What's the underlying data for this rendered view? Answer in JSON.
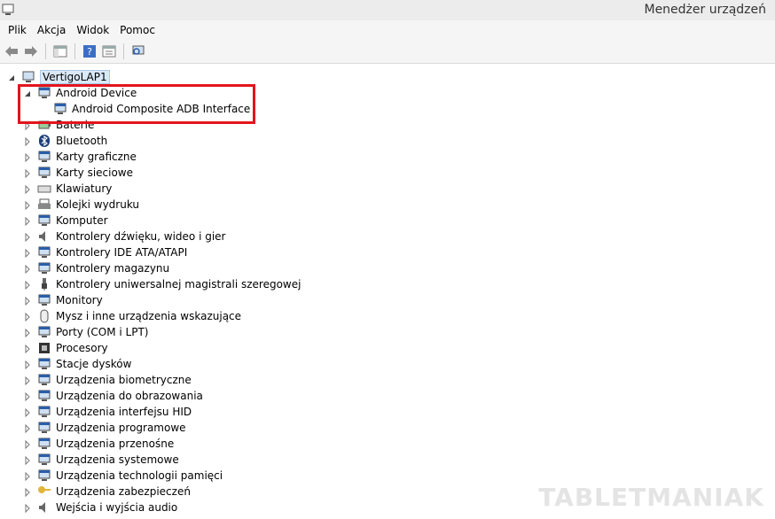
{
  "window": {
    "title": "Menedżer urządzeń"
  },
  "menu": [
    "Plik",
    "Akcja",
    "Widok",
    "Pomoc"
  ],
  "toolbar": [
    "back-icon",
    "forward-icon",
    "show-hide-tree-icon",
    "help-icon",
    "properties-icon",
    "scan-hardware-icon"
  ],
  "tree": {
    "root": "VertigoLAP1",
    "categories": [
      {
        "label": "Android Device",
        "expanded": true,
        "children": [
          "Android Composite ADB Interface"
        ]
      },
      {
        "label": "Baterie"
      },
      {
        "label": "Bluetooth"
      },
      {
        "label": "Karty graficzne"
      },
      {
        "label": "Karty sieciowe"
      },
      {
        "label": "Klawiatury"
      },
      {
        "label": "Kolejki wydruku"
      },
      {
        "label": "Komputer"
      },
      {
        "label": "Kontrolery dźwięku, wideo i gier"
      },
      {
        "label": "Kontrolery IDE ATA/ATAPI"
      },
      {
        "label": "Kontrolery magazynu"
      },
      {
        "label": "Kontrolery uniwersalnej magistrali szeregowej"
      },
      {
        "label": "Monitory"
      },
      {
        "label": "Mysz i inne urządzenia wskazujące"
      },
      {
        "label": "Porty (COM i LPT)"
      },
      {
        "label": "Procesory"
      },
      {
        "label": "Stacje dysków"
      },
      {
        "label": "Urządzenia biometryczne"
      },
      {
        "label": "Urządzenia do obrazowania"
      },
      {
        "label": "Urządzenia interfejsu HID"
      },
      {
        "label": "Urządzenia programowe"
      },
      {
        "label": "Urządzenia przenośne"
      },
      {
        "label": "Urządzenia systemowe"
      },
      {
        "label": "Urządzenia technologii pamięci"
      },
      {
        "label": "Urządzenia zabezpieczeń"
      },
      {
        "label": "Wejścia i wyjścia audio"
      }
    ]
  },
  "watermark": "TABLETMANIAK",
  "colors": {
    "highlight": "#e4141d",
    "selection": "#dbe9f7"
  }
}
